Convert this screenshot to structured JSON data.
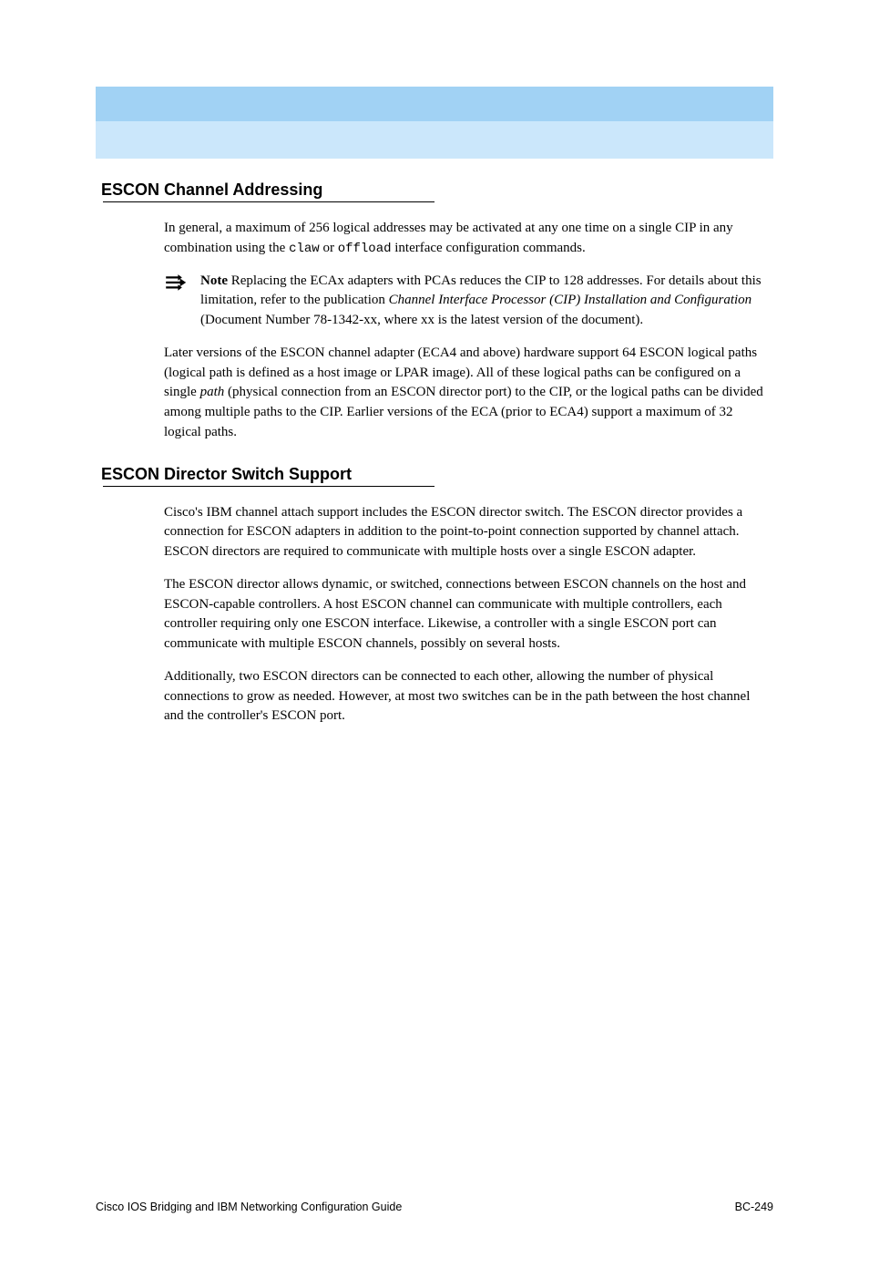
{
  "section1": {
    "heading": "ESCON Channel Addressing",
    "p1_a": "In general, a maximum of 256 logical addresses may be activated at any one time on a single CIP in any combination using the ",
    "p1_cmd": "claw",
    "p1_b": " or ",
    "p1_cmd2": "offload",
    "p1_c": " interface configuration commands.",
    "note_label": "Note",
    "note_a": "   Replacing the ECAx adapters with PCAs reduces the CIP to 128 addresses. For details about this limitation, refer to the publication ",
    "note_em": "Channel Interface Processor (CIP) Installation and Configuration",
    "note_b": " (Document Number 78-1342-xx, where xx is the latest version of the document).",
    "p2_a": "Later versions of the ESCON channel adapter (ECA4 and above) hardware support 64 ESCON logical paths (logical path is defined as a host image or LPAR image). All of these logical paths can be configured on a single ",
    "p2_em": "path",
    "p2_b": " (physical connection from an ESCON director port) to the CIP, or the logical paths can be divided among multiple paths to the CIP. Earlier versions of the ECA (prior to ECA4) support a maximum of 32 logical paths."
  },
  "section2": {
    "heading": "ESCON Director Switch Support",
    "p1": "Cisco's IBM channel attach support includes the ESCON director switch. The ESCON director provides a connection for ESCON adapters in addition to the point-to-point connection supported by channel attach. ESCON directors are required to communicate with multiple hosts over a single ESCON adapter.",
    "p2": "The ESCON director allows dynamic, or switched, connections between ESCON channels on the host and ESCON-capable controllers. A host ESCON channel can communicate with multiple controllers, each controller requiring only one ESCON interface. Likewise, a controller with a single ESCON port can communicate with multiple ESCON channels, possibly on several hosts.",
    "p3": "Additionally, two ESCON directors can be connected to each other, allowing the number of physical connections to grow as needed. However, at most two switches can be in the path between the host channel and the controller's ESCON port."
  },
  "footer": {
    "left": "Cisco IOS Bridging and IBM Networking Configuration Guide",
    "right": "BC-249"
  }
}
